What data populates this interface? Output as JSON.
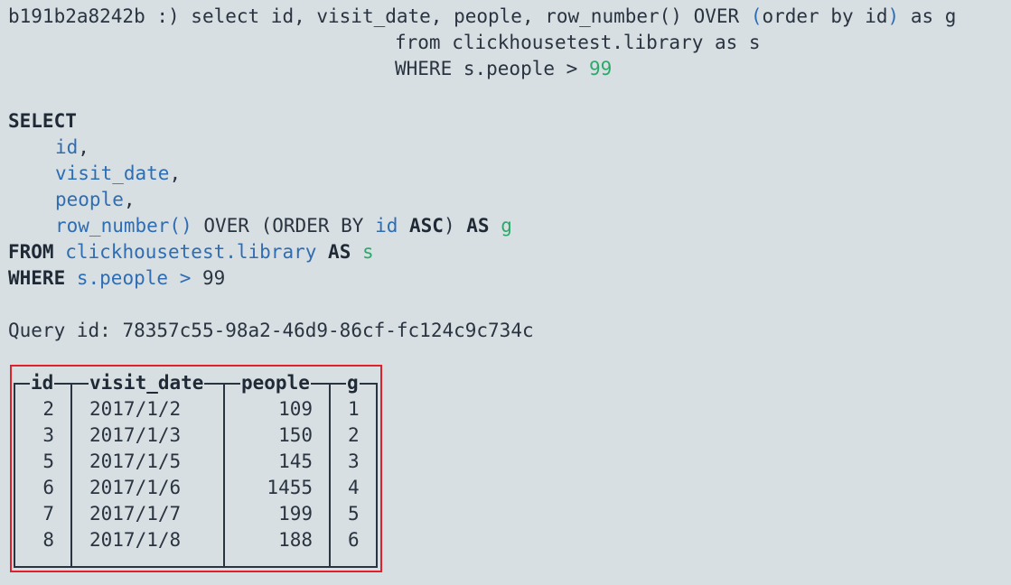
{
  "terminal": {
    "prompt": "b191b2a8242b :) ",
    "input_lines": [
      "select id, visit_date, people, row_number() OVER (order by id) as g",
      "from clickhousetest.library as s",
      "WHERE s.people > 99"
    ],
    "formatted": {
      "select_kw": "SELECT",
      "col_id": "id",
      "col_visit_date": "visit_date",
      "col_people": "people",
      "row_number_fn": "row_number()",
      "over_kw": "OVER",
      "order_by": "(ORDER BY",
      "order_col": "id",
      "asc_kw": "ASC",
      "as_kw": "AS",
      "alias_g": "g",
      "from_kw": "FROM",
      "table": "clickhousetest.library",
      "alias_s": "s",
      "where_kw": "WHERE",
      "where_col": "s.people",
      "gt": ">",
      "where_val": "99"
    },
    "query_id_label": "Query id:",
    "query_id": "78357c55-98a2-46d9-86cf-fc124c9c734c"
  },
  "result": {
    "columns": [
      "id",
      "visit_date",
      "people",
      "g"
    ],
    "rows": [
      [
        "2",
        "2017/1/2",
        "109",
        "1"
      ],
      [
        "3",
        "2017/1/3",
        "150",
        "2"
      ],
      [
        "5",
        "2017/1/5",
        "145",
        "3"
      ],
      [
        "6",
        "2017/1/6",
        "1455",
        "4"
      ],
      [
        "7",
        "2017/1/7",
        "199",
        "5"
      ],
      [
        "8",
        "2017/1/8",
        "188",
        "6"
      ]
    ]
  },
  "colors": {
    "background": "#d7dfe2",
    "keyword": "#1f2a36",
    "identifier": "#2f6db3",
    "literal": "#2ea86a",
    "highlight_box": "#e0202a"
  }
}
